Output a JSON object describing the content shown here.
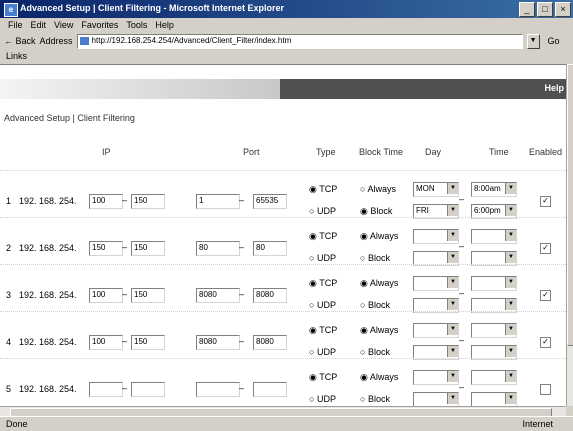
{
  "window": {
    "title": "Advanced Setup | Client Filtering - Microsoft Internet Explorer"
  },
  "menu": [
    "File",
    "Edit",
    "View",
    "Favorites",
    "Tools",
    "Help"
  ],
  "address": {
    "back_label": "← Back",
    "label": "Address",
    "url": "http://192.168.254.254/Advanced/Client_Filter/index.htm",
    "go_label": "Go"
  },
  "links_label": "Links",
  "banner_right_text": "Help",
  "page_title": "Advanced Setup | Client Filtering",
  "headers": {
    "ip": "IP",
    "port": "Port",
    "type": "Type",
    "block_time": "Block Time",
    "day": "Day",
    "time": "Time",
    "enable": "Enabled"
  },
  "rows": [
    {
      "num": "1",
      "ip_prefix": "192. 168. 254.",
      "ip_from": "100",
      "ip_to": "150",
      "port_from": "1",
      "port_to": "65535",
      "type_tcp": "TCP",
      "type_udp": "UDP",
      "block_always": "Always",
      "block_block": "Block",
      "day_from": "MON",
      "day_to": "FRI",
      "time_from": "8:00am",
      "time_to": "6:00pm",
      "enabled": true
    },
    {
      "num": "2",
      "ip_prefix": "192. 168. 254.",
      "ip_from": "150",
      "ip_to": "150",
      "port_from": "80",
      "port_to": "80",
      "type_tcp": "TCP",
      "type_udp": "UDP",
      "block_always": "Always",
      "block_block": "Block",
      "day_from": "",
      "day_to": "",
      "time_from": "",
      "time_to": "",
      "enabled": true
    },
    {
      "num": "3",
      "ip_prefix": "192. 168. 254.",
      "ip_from": "100",
      "ip_to": "150",
      "port_from": "8080",
      "port_to": "8080",
      "type_tcp": "TCP",
      "type_udp": "UDP",
      "block_always": "Always",
      "block_block": "Block",
      "day_from": "",
      "day_to": "",
      "time_from": "",
      "time_to": "",
      "enabled": true
    },
    {
      "num": "4",
      "ip_prefix": "192. 168. 254.",
      "ip_from": "100",
      "ip_to": "150",
      "port_from": "8080",
      "port_to": "8080",
      "type_tcp": "TCP",
      "type_udp": "UDP",
      "block_always": "Always",
      "block_block": "Block",
      "day_from": "",
      "day_to": "",
      "time_from": "",
      "time_to": "",
      "enabled": true
    },
    {
      "num": "5",
      "ip_prefix": "192. 168. 254.",
      "ip_from": "",
      "ip_to": "",
      "port_from": "",
      "port_to": "",
      "type_tcp": "TCP",
      "type_udp": "UDP",
      "block_always": "Always",
      "block_block": "Block",
      "day_from": "",
      "day_to": "",
      "time_from": "",
      "time_to": "",
      "enabled": false
    }
  ],
  "status": {
    "left": "Done",
    "zone": "Internet"
  }
}
